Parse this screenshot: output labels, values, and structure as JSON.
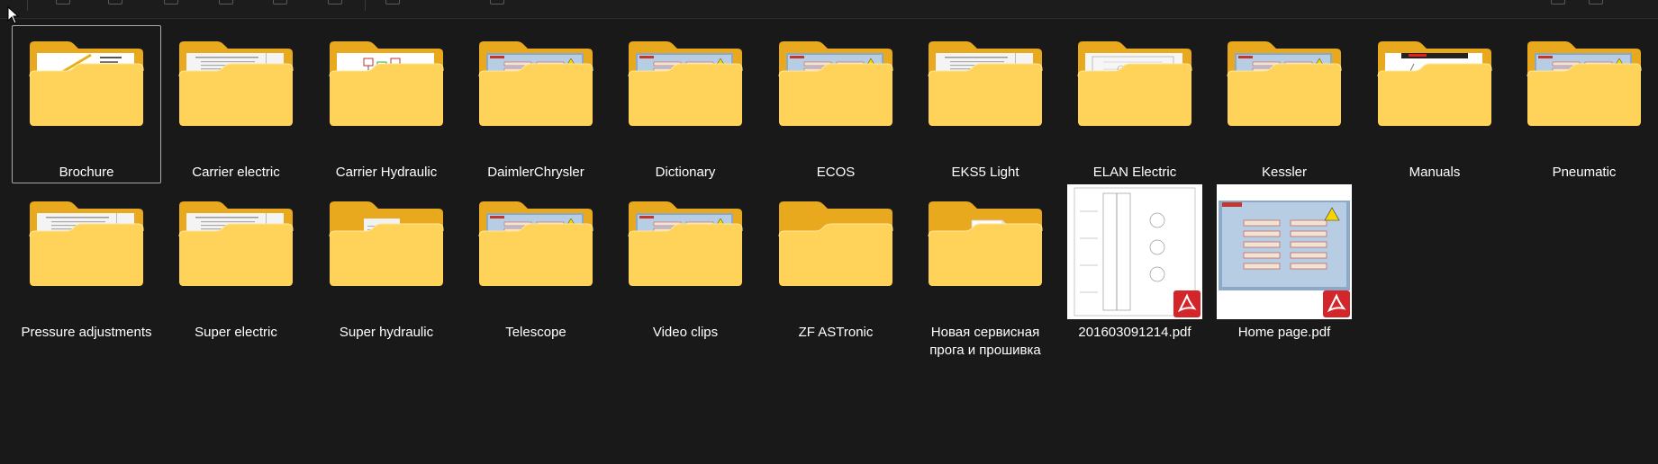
{
  "items": [
    {
      "label": "Brochure",
      "type": "folder",
      "preview": "brochure",
      "selected": true
    },
    {
      "label": "Carrier electric",
      "type": "folder",
      "preview": "doc"
    },
    {
      "label": "Carrier Hydraulic",
      "type": "folder",
      "preview": "schematic"
    },
    {
      "label": "DaimlerChrysler",
      "type": "folder",
      "preview": "menu"
    },
    {
      "label": "Dictionary",
      "type": "folder",
      "preview": "menu"
    },
    {
      "label": "ECOS",
      "type": "folder",
      "preview": "menu"
    },
    {
      "label": "EKS5 Light",
      "type": "folder",
      "preview": "doc"
    },
    {
      "label": "ELAN Electric",
      "type": "folder",
      "preview": "drawing"
    },
    {
      "label": "Kessler",
      "type": "folder",
      "preview": "menu"
    },
    {
      "label": "Manuals",
      "type": "folder",
      "preview": "crane"
    },
    {
      "label": "Pneumatic",
      "type": "folder",
      "preview": "menu"
    },
    {
      "label": "Pressure adjustments",
      "type": "folder",
      "preview": "doc"
    },
    {
      "label": "Super electric",
      "type": "folder",
      "preview": "doc"
    },
    {
      "label": "Super hydraulic",
      "type": "folder",
      "preview": "page"
    },
    {
      "label": "Telescope",
      "type": "folder",
      "preview": "menu"
    },
    {
      "label": "Video clips",
      "type": "folder",
      "preview": "menu"
    },
    {
      "label": "ZF ASTronic",
      "type": "folder",
      "preview": "empty"
    },
    {
      "label": "Новая сервисная прога и прошивка",
      "type": "folder",
      "preview": "file"
    },
    {
      "label": "201603091214.pdf",
      "type": "pdf",
      "preview": "drawing"
    },
    {
      "label": "Home page.pdf",
      "type": "pdf",
      "preview": "menu"
    }
  ],
  "icons": {
    "folder": "folder-icon",
    "pdf_badge": "acrobat-pdf-icon"
  },
  "colors": {
    "background": "#191919",
    "folder_back": "#e9a91f",
    "folder_front": "#ffd25a",
    "pdf_badge": "#d3262b",
    "selection_border": "#a9a9a9"
  }
}
